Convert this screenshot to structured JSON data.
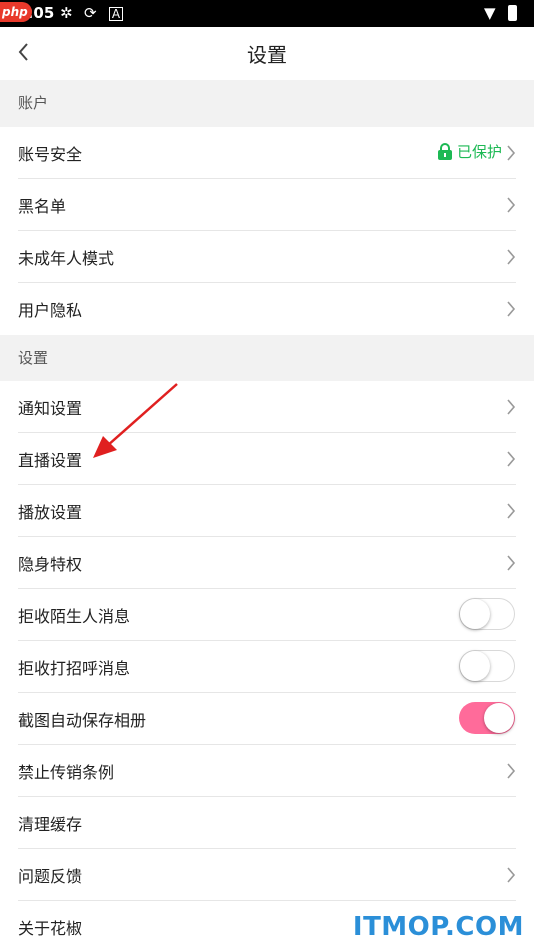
{
  "status_bar": {
    "time": "3:05",
    "badge": "php"
  },
  "nav": {
    "title": "设置"
  },
  "sections": [
    {
      "header": "账户"
    },
    {
      "header": "设置"
    }
  ],
  "rows": {
    "account_security": {
      "label": "账号安全",
      "status": "已保护",
      "status_color": "#1db954"
    },
    "blacklist": {
      "label": "黑名单"
    },
    "minor_mode": {
      "label": "未成年人模式"
    },
    "user_privacy": {
      "label": "用户隐私"
    },
    "notification": {
      "label": "通知设置"
    },
    "live": {
      "label": "直播设置"
    },
    "playback": {
      "label": "播放设置"
    },
    "stealth": {
      "label": "隐身特权"
    },
    "reject_stranger": {
      "label": "拒收陌生人消息",
      "toggle": false
    },
    "reject_greeting": {
      "label": "拒收打招呼消息",
      "toggle": false
    },
    "screenshot_save": {
      "label": "截图自动保存相册",
      "toggle": true
    },
    "mlm_rules": {
      "label": "禁止传销条例"
    },
    "clear_cache": {
      "label": "清理缓存"
    },
    "feedback": {
      "label": "问题反馈"
    },
    "about": {
      "label": "关于花椒"
    }
  },
  "colors": {
    "toggle_on": "#ff6b9a",
    "accent_green": "#1db954",
    "annotation_arrow": "#e02020"
  },
  "watermark": "ITMOP.COM"
}
